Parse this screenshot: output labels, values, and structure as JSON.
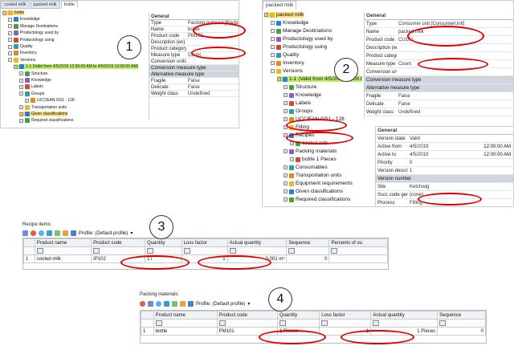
{
  "panel1": {
    "tabs": [
      "cooled milk",
      "packed milk",
      "bottle"
    ],
    "tree": [
      {
        "label": "bottle",
        "level": 0,
        "highlight": "yellow"
      },
      {
        "label": "Knowledge",
        "level": 1
      },
      {
        "label": "Manage Destinations",
        "level": 1
      },
      {
        "label": "Productology used by",
        "level": 1
      },
      {
        "label": "Productology using",
        "level": 1
      },
      {
        "label": "Quality",
        "level": 1
      },
      {
        "label": "Inventory",
        "level": 1
      },
      {
        "label": "Versions",
        "level": 1
      },
      {
        "label": "1-1 (Valid from 4/5/2019 12:00:00 AM to 4/5/2019 12:00:00 AM)",
        "level": 2,
        "highlight": "green"
      },
      {
        "label": "Structure",
        "level": 3
      },
      {
        "label": "Knowledge",
        "level": 3
      },
      {
        "label": "Labels",
        "level": 3
      },
      {
        "label": "Groups",
        "level": 3
      },
      {
        "label": "UCC/EAN GS1 - 128",
        "level": 4
      },
      {
        "label": "Transportation units",
        "level": 3
      },
      {
        "label": "Given classifications",
        "level": 3,
        "highlight": "yellow"
      },
      {
        "label": "Required classifications",
        "level": 3
      }
    ],
    "props_header": "General",
    "props": [
      {
        "k": "Type",
        "v": "Packing material [PackingMaterial]"
      },
      {
        "k": "Name",
        "v": "bottle"
      },
      {
        "k": "Product code",
        "v": "PM101"
      },
      {
        "k": "Description (en)",
        "v": ""
      },
      {
        "k": "Product category",
        "v": ""
      },
      {
        "k": "Measure type",
        "v": "Count"
      },
      {
        "k": "Conversion units",
        "v": ""
      },
      {
        "k": "Conversion measure type",
        "v": "",
        "section": true
      },
      {
        "k": "Alternative measure type",
        "v": "",
        "section": true
      },
      {
        "k": "Fragile",
        "v": "False"
      },
      {
        "k": "Delicate",
        "v": "False"
      },
      {
        "k": "Weight class",
        "v": "Undefined"
      }
    ],
    "badge": "1"
  },
  "panel2": {
    "tabs": [
      "packed milk"
    ],
    "tree": [
      {
        "label": "packed milk",
        "level": 0,
        "highlight": "yellow"
      },
      {
        "label": "Knowledge",
        "level": 1
      },
      {
        "label": "Manage Destinations",
        "level": 1
      },
      {
        "label": "Productology used by",
        "level": 1
      },
      {
        "label": "Productology using",
        "level": 1
      },
      {
        "label": "Quality",
        "level": 1
      },
      {
        "label": "Inventory",
        "level": 1
      },
      {
        "label": "Versions",
        "level": 1
      },
      {
        "label": "1-1 (Valid from 4/5/2019 12:00:0",
        "level": 2,
        "highlight": "green"
      },
      {
        "label": "Structure",
        "level": 3
      },
      {
        "label": "Knowledge",
        "level": 3
      },
      {
        "label": "Labels",
        "level": 3
      },
      {
        "label": "Groups",
        "level": 3
      },
      {
        "label": "UCC/EAN GS1 - 128",
        "level": 3
      },
      {
        "label": "Filling",
        "level": 3
      },
      {
        "label": "Recipes",
        "level": 3
      },
      {
        "label": "cooled milk",
        "level": 4
      },
      {
        "label": "Packing materials",
        "level": 3
      },
      {
        "label": "bottle 1 Pieces",
        "level": 4
      },
      {
        "label": "Consumables",
        "level": 3
      },
      {
        "label": "Transportation units",
        "level": 3
      },
      {
        "label": "Equipment requirements",
        "level": 3
      },
      {
        "label": "Given classifications",
        "level": 3
      },
      {
        "label": "Required classifications",
        "level": 3
      }
    ],
    "props_header": "General",
    "props": [
      {
        "k": "Type",
        "v": "Consumer unit [ConsumerUnit]"
      },
      {
        "k": "Name",
        "v": "packed milk"
      },
      {
        "k": "Product code",
        "v": "CU101"
      },
      {
        "k": "Description (en)",
        "v": ""
      },
      {
        "k": "Product category",
        "v": ""
      },
      {
        "k": "Measure type",
        "v": "Count"
      },
      {
        "k": "Conversion units",
        "v": ""
      },
      {
        "k": "Conversion measure type",
        "v": "",
        "section": true
      },
      {
        "k": "Alternative measure type",
        "v": "",
        "section": true
      },
      {
        "k": "Fragile",
        "v": "False"
      },
      {
        "k": "Delicate",
        "v": "False"
      },
      {
        "k": "Weight class",
        "v": "Undefined"
      }
    ],
    "ver_header": "General",
    "ver_props": [
      {
        "k": "Version state",
        "v": "Valid"
      },
      {
        "k": "Active from",
        "v": "4/5/2019",
        "t": "12:00:00 AM"
      },
      {
        "k": "Active to",
        "v": "4/5/2019",
        "t": "12:00:00 AM"
      },
      {
        "k": "Priority",
        "v": "0"
      },
      {
        "k": "Version description",
        "v": "1"
      },
      {
        "k": "Version number",
        "v": "1",
        "section": true
      },
      {
        "k": "Site",
        "v": "Ketchwig"
      },
      {
        "k": "Sscc code generator",
        "v": "(none)"
      },
      {
        "k": "Process",
        "v": "Filling"
      }
    ],
    "badge": "2"
  },
  "panel3": {
    "caption": "Recipe items:",
    "profile": "Profile: (Default profile)",
    "columns": [
      "",
      "Product name",
      "Product code",
      "Quantity",
      "Loss factor",
      "Actual quantity",
      "Sequence",
      "Percents of ou"
    ],
    "rows": [
      [
        "1",
        "cooled milk",
        "IP102",
        "1 l",
        "1",
        "0,001 m³",
        "0",
        ""
      ]
    ],
    "badge": "3"
  },
  "panel4": {
    "caption": "Packing materials:",
    "profile": "Profile: (Default profile)",
    "columns": [
      "",
      "Product name",
      "Product code",
      "Quantity",
      "Loss factor",
      "Actual quantity",
      "Sequence"
    ],
    "rows": [
      [
        "1",
        "bottle",
        "PM101",
        "1 Pieces",
        "1",
        "1 Pieces",
        "0"
      ]
    ],
    "badge": "4"
  },
  "colors": {
    "red": "#e00000",
    "yellow": "#ffe07a",
    "green": "#bdf06a"
  }
}
